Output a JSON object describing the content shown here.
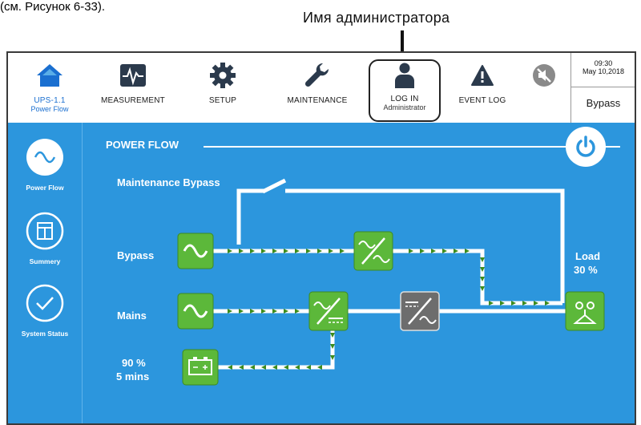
{
  "caption_top": "(см. Рисунок 6-33).",
  "callout": {
    "label": "Имя администратора"
  },
  "nav": {
    "home": {
      "label": "UPS-1.1",
      "sub": "Power Flow"
    },
    "measurement": {
      "label": "MEASUREMENT"
    },
    "setup": {
      "label": "SETUP"
    },
    "maintenance": {
      "label": "MAINTENANCE"
    },
    "login": {
      "label": "LOG IN",
      "sub": "Administrator"
    },
    "eventlog": {
      "label": "EVENT LOG"
    },
    "mute": {
      "icon": "mute-icon"
    }
  },
  "clock": {
    "time": "09:30",
    "date": "May 10,2018",
    "mode": "Bypass"
  },
  "sidebar": {
    "items": [
      {
        "label": "Power Flow",
        "icon": "sine-wave-icon"
      },
      {
        "label": "Summery",
        "icon": "summary-grid-icon"
      },
      {
        "label": "System Status",
        "icon": "checkmark-icon"
      }
    ]
  },
  "flow": {
    "title": "POWER FLOW",
    "maintenance_bypass": "Maintenance Bypass",
    "bypass": "Bypass",
    "mains": "Mains",
    "battery_pct": "90 %",
    "battery_time": "5 mins",
    "load_label": "Load",
    "load_pct": "30 %"
  },
  "colors": {
    "panel_blue": "#2c96dd",
    "block_green": "#5cb83a",
    "inverter_gray": "#6d6d6d",
    "brand_blue": "#1a6fd0",
    "arrow_green": "#3c8c1c"
  }
}
